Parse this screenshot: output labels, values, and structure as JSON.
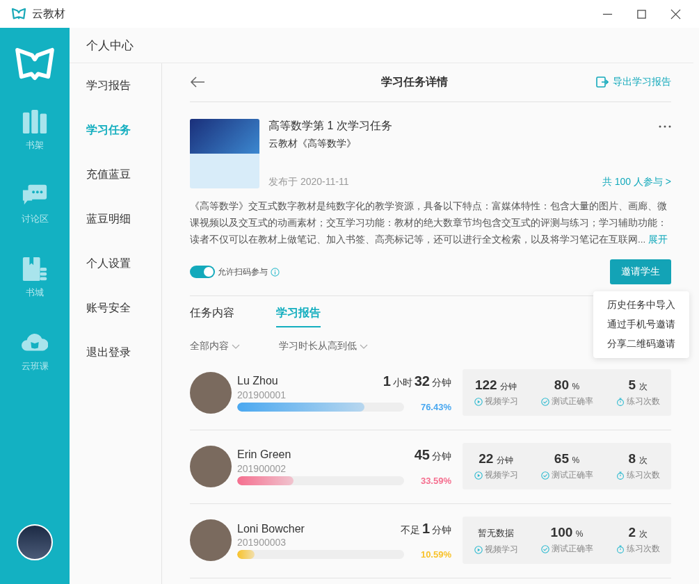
{
  "window": {
    "title": "云教材"
  },
  "rail": [
    {
      "label": "书架",
      "kind": "shelf"
    },
    {
      "label": "讨论区",
      "kind": "chat"
    },
    {
      "label": "书城",
      "kind": "store"
    },
    {
      "label": "云班课",
      "kind": "cloud"
    }
  ],
  "nav": {
    "title": "个人中心",
    "items": [
      {
        "label": "学习报告",
        "selected": false
      },
      {
        "label": "学习任务",
        "selected": true
      },
      {
        "label": "充值蓝豆",
        "selected": false
      },
      {
        "label": "蓝豆明细",
        "selected": false
      },
      {
        "label": "个人设置",
        "selected": false
      },
      {
        "label": "账号安全",
        "selected": false
      },
      {
        "label": "退出登录",
        "selected": false
      }
    ]
  },
  "page": {
    "title": "学习任务详情",
    "export": "导出学习报告"
  },
  "task": {
    "title": "高等数学第 1 次学习任务",
    "book": "云教材《高等数学》",
    "published": "发布于 2020-11-11",
    "participants": "共 100 人参与 >",
    "description": "《高等数学》交互式数字教材是纯数字化的教学资源，具备以下特点：富媒体特性：包含大量的图片、画廊、微课视频以及交互式的动画素材；交互学习功能：教材的绝大数章节均包含交互式的评测与练习；学习辅助功能：读者不仅可以在教材上做笔记、加入书签、高亮标记等，还可以进行全文检索，以及将学习笔记在互联网...",
    "expand": "展开",
    "scan_toggle": {
      "label": "允许扫码参与",
      "on": true
    },
    "invite": "邀请学生"
  },
  "invite_menu": [
    "历史任务中导入",
    "通过手机号邀请",
    "分享二维码邀请"
  ],
  "tabs": [
    {
      "label": "任务内容",
      "selected": false
    },
    {
      "label": "学习报告",
      "selected": true
    }
  ],
  "filters": [
    "全部内容",
    "学习时长从高到低"
  ],
  "students": [
    {
      "name": "Lu Zhou",
      "id": "201900001",
      "duration": [
        {
          "kind": "num",
          "text": "1"
        },
        {
          "kind": "unit",
          "text": "小时"
        },
        {
          "kind": "num",
          "text": "32"
        },
        {
          "kind": "unit",
          "text": "分钟"
        }
      ],
      "level": 0.7643,
      "percent": "76.43%",
      "color": "#4aa8f0",
      "stats": [
        {
          "kind": "number",
          "value": "122",
          "unit": "分钟",
          "label": "视频学习"
        },
        {
          "kind": "number",
          "value": "80",
          "unit": "%",
          "label": "测试正确率"
        },
        {
          "kind": "number",
          "value": "5",
          "unit": "次",
          "label": "练习次数"
        }
      ]
    },
    {
      "name": "Erin Green",
      "id": "201900002",
      "duration": [
        {
          "kind": "num",
          "text": "45"
        },
        {
          "kind": "unit",
          "text": "分钟"
        }
      ],
      "level": 0.3359,
      "percent": "33.59%",
      "color": "#f56f8f",
      "stats": [
        {
          "kind": "number",
          "value": "22",
          "unit": "分钟",
          "label": "视频学习"
        },
        {
          "kind": "number",
          "value": "65",
          "unit": "%",
          "label": "测试正确率"
        },
        {
          "kind": "number",
          "value": "8",
          "unit": "次",
          "label": "练习次数"
        }
      ]
    },
    {
      "name": "Loni Bowcher",
      "id": "201900003",
      "duration": [
        {
          "kind": "unit",
          "text": "不足"
        },
        {
          "kind": "num",
          "text": "1"
        },
        {
          "kind": "unit",
          "text": "分钟"
        }
      ],
      "level": 0.1059,
      "percent": "10.59%",
      "color": "#f8c22a",
      "stats": [
        {
          "kind": "note",
          "value": "暂无数据",
          "label": "视频学习"
        },
        {
          "kind": "number",
          "value": "100",
          "unit": "%",
          "label": "测试正确率"
        },
        {
          "kind": "number",
          "value": "2",
          "unit": "次",
          "label": "练习次数"
        }
      ]
    }
  ]
}
